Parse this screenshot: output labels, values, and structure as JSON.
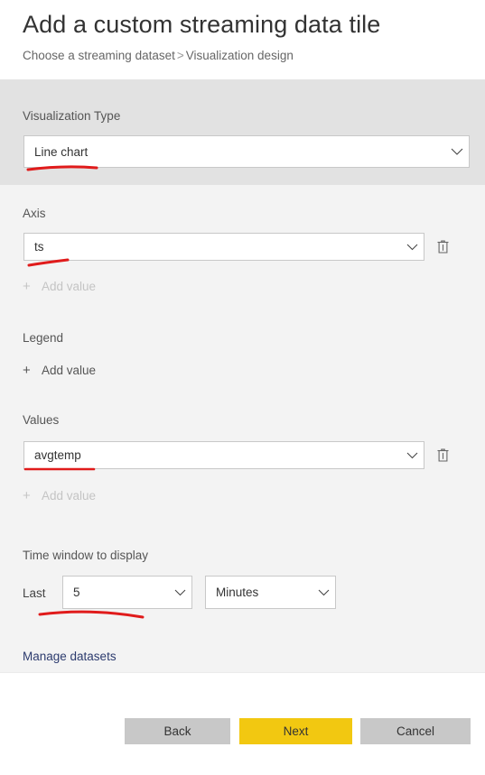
{
  "header": {
    "title": "Add a custom streaming data tile",
    "breadcrumb": {
      "step1": "Choose a streaming dataset",
      "separator": ">",
      "step2": "Visualization design"
    }
  },
  "form": {
    "visualization_type": {
      "label": "Visualization Type",
      "value": "Line chart",
      "chevron_icon": "chevron-down-icon"
    },
    "axis": {
      "label": "Axis",
      "value": "ts",
      "chevron_icon": "chevron-down-icon",
      "delete_icon": "trash-icon",
      "add_value_label": "Add value",
      "add_value_plus_icon": "plus-icon",
      "add_value_enabled": false
    },
    "legend": {
      "label": "Legend",
      "add_value_label": "Add value",
      "add_value_plus_icon": "plus-icon",
      "add_value_enabled": true
    },
    "values": {
      "label": "Values",
      "value": "avgtemp",
      "chevron_icon": "chevron-down-icon",
      "delete_icon": "trash-icon",
      "add_value_label": "Add value",
      "add_value_plus_icon": "plus-icon",
      "add_value_enabled": false
    },
    "time_window": {
      "label": "Time window to display",
      "last_label": "Last",
      "amount_value": "5",
      "unit_value": "Minutes",
      "chevron_icon": "chevron-down-icon"
    },
    "manage_datasets_link": "Manage datasets"
  },
  "footer": {
    "back_label": "Back",
    "next_label": "Next",
    "cancel_label": "Cancel"
  },
  "colors": {
    "accent_yellow": "#f2c811",
    "button_gray": "#c8c8c8",
    "band_dark": "#e2e2e2",
    "band_light": "#f3f3f3",
    "link_navy": "#2c3b6e",
    "annotation_red": "#e01b1b"
  },
  "annotations": {
    "type": "hand-drawn-red-underline",
    "marks": [
      {
        "name": "underline-visualization-type",
        "target": "Line chart"
      },
      {
        "name": "underline-axis-value",
        "target": "ts"
      },
      {
        "name": "underline-values-value",
        "target": "avgtemp"
      },
      {
        "name": "underline-time-window",
        "target": "Last 5"
      }
    ]
  }
}
